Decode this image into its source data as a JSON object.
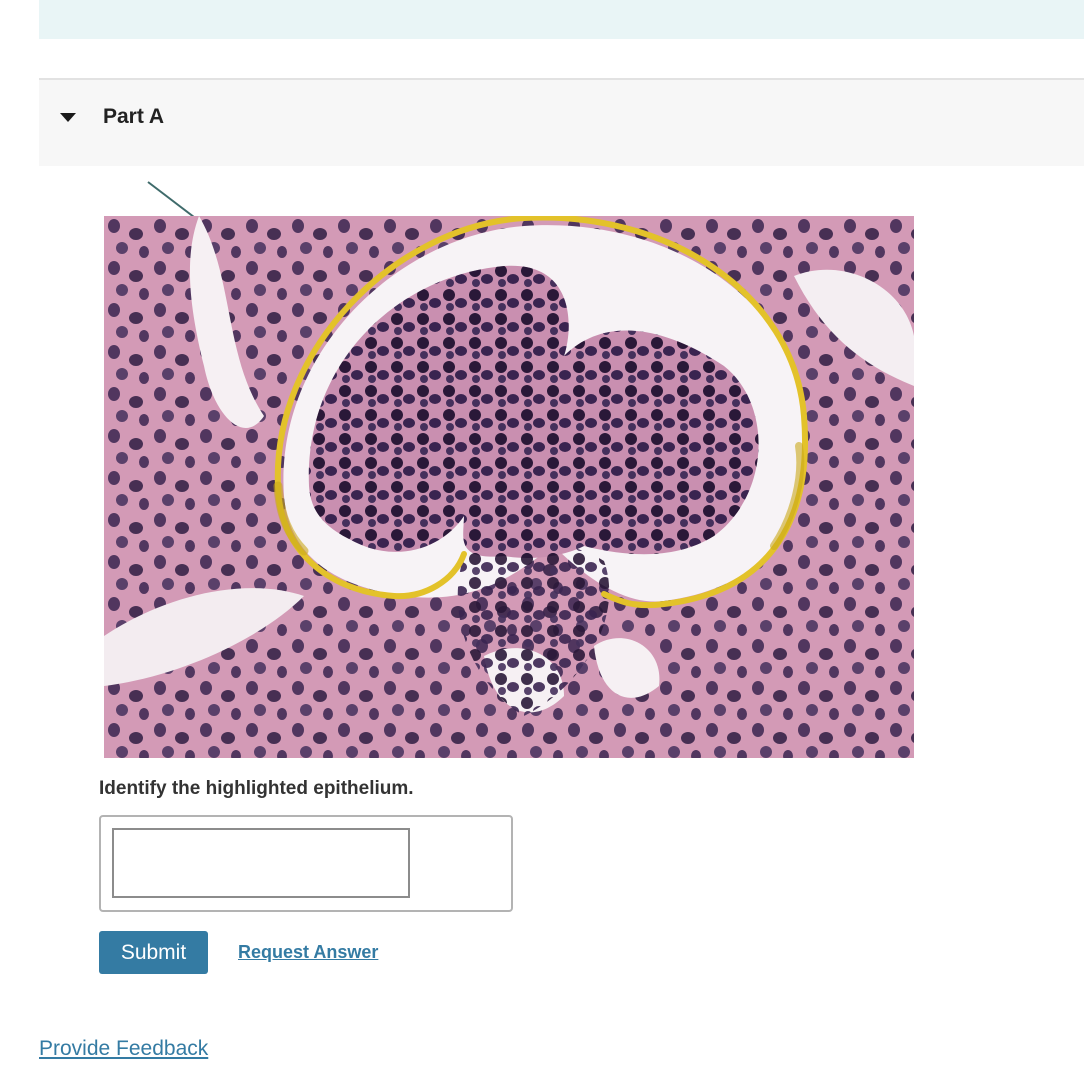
{
  "part": {
    "title": "Part A",
    "expanded": true,
    "icon": "caret-down-icon"
  },
  "figure": {
    "subject": "histology-micrograph-renal-corpuscle",
    "highlight_color": "#e3c22a",
    "leader_line_color": "#3f6b6b",
    "stain_colors": [
      "#d89ab8",
      "#3a2450",
      "#f4eef2"
    ]
  },
  "question": {
    "text": "Identify the highlighted epithelium."
  },
  "answer": {
    "value": "",
    "placeholder": ""
  },
  "actions": {
    "submit_label": "Submit",
    "request_label": "Request Answer",
    "accent_color": "#347ba3"
  },
  "footer": {
    "feedback_label": "Provide Feedback"
  }
}
